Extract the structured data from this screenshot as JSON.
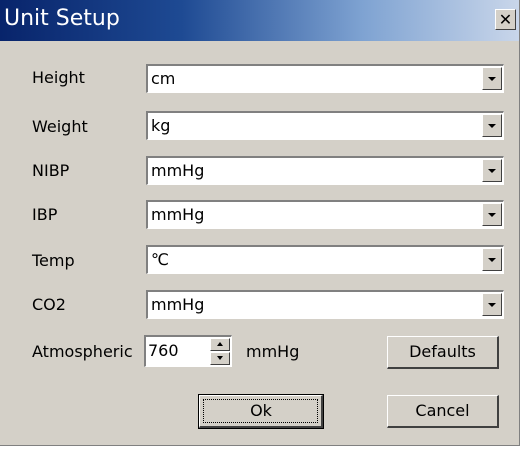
{
  "window": {
    "title": "Unit Setup",
    "close_glyph": "✕"
  },
  "fields": [
    {
      "label": "Height",
      "value": "cm"
    },
    {
      "label": "Weight",
      "value": "kg"
    },
    {
      "label": "NIBP",
      "value": "mmHg"
    },
    {
      "label": "IBP",
      "value": "mmHg"
    },
    {
      "label": "Temp",
      "value": "℃"
    },
    {
      "label": "CO2",
      "value": "mmHg"
    }
  ],
  "atmospheric": {
    "label": "Atmospheric",
    "value": "760",
    "unit": "mmHg"
  },
  "buttons": {
    "defaults": "Defaults",
    "ok": "Ok",
    "cancel": "Cancel"
  },
  "colors": {
    "dialog_bg": "#d4d0c8",
    "title_start": "#08246b",
    "title_end": "#c9d6ea"
  }
}
